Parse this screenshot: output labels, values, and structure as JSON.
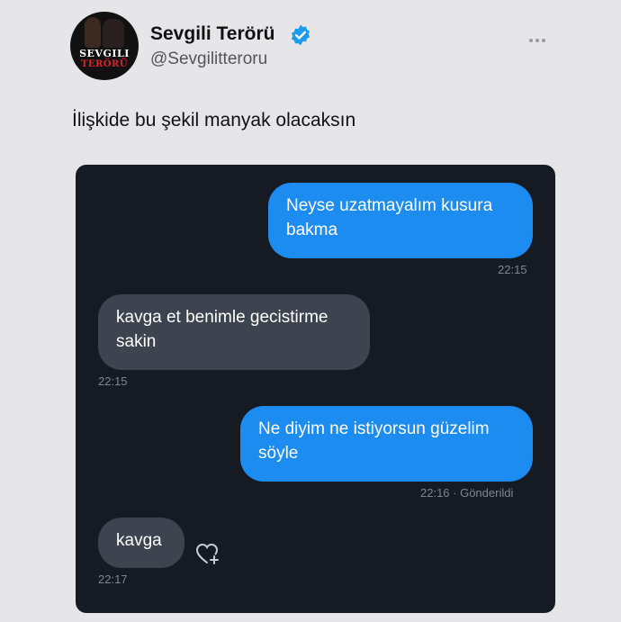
{
  "header": {
    "display_name": "Sevgili Terörü",
    "handle": "@Sevgilitteroru",
    "avatar_text_top": "SEVGILI",
    "avatar_text_bottom": "TERÖRÜ",
    "verified_icon": "verified-badge-icon",
    "more_icon": "more-horizontal-icon"
  },
  "tweet": {
    "text": "İlişkide bu şekil manyak olacaksın"
  },
  "chat": {
    "messages": [
      {
        "direction": "outgoing",
        "line1": "Neyse uzatmayalım kusura",
        "line2": "bakma",
        "time": "22:15"
      },
      {
        "direction": "incoming",
        "line1": "kavga et benimle gecistirme",
        "line2": "sakin",
        "time": "22:15"
      },
      {
        "direction": "outgoing",
        "line1": "Ne diyim ne istiyorsun güzelim",
        "line2": "söyle",
        "time": "22:16 · Gönderildi"
      },
      {
        "direction": "incoming",
        "line1": "kavga",
        "line2": "",
        "time": "22:17"
      }
    ],
    "reaction_icon": "heart-plus-icon"
  },
  "colors": {
    "outgoing_bubble": "#1d8cf0",
    "incoming_bubble": "#3e4350",
    "chat_background": "#161a22",
    "verified": "#1d9bf0"
  }
}
